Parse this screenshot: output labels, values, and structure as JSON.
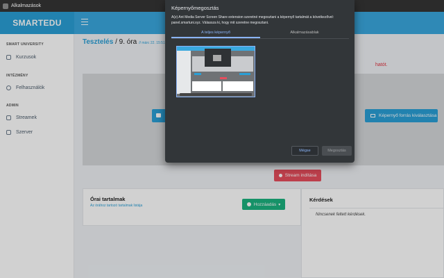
{
  "titlebar": {
    "app_name": "Alkalmazások"
  },
  "brand": {
    "name": "SMARTEDU"
  },
  "sidebar": {
    "sections": [
      {
        "label": "SMART UNIVERSITY",
        "items": [
          {
            "label": "Kurzusok",
            "icon": "book-icon"
          }
        ]
      },
      {
        "label": "INTÉZMÉNY",
        "items": [
          {
            "label": "Felhasználók",
            "icon": "user-icon"
          }
        ]
      },
      {
        "label": "ADMIN",
        "items": [
          {
            "label": "Streamek",
            "icon": "video-icon"
          },
          {
            "label": "Szerver",
            "icon": "server-icon"
          }
        ]
      }
    ]
  },
  "breadcrumb": {
    "course": "Tesztelés",
    "separator": " / ",
    "lesson": "9. óra",
    "date": "// márc 22. 15:51"
  },
  "main": {
    "error_text": "hatót.",
    "screen_button": "Képernyő forrás kiválasztása",
    "stream_button": "Stream indítása"
  },
  "content_card": {
    "title": "Órai tartalmak",
    "subtitle": "Az órához tartozó tartalmak listája",
    "add_button": "Hozzáadás"
  },
  "questions_card": {
    "title": "Kérdések",
    "empty": "Nincsenek feltett kérdések."
  },
  "dialog": {
    "title": "Képernyőmegosztás",
    "description": "A(z) Ant Media Server Screen Share extension szeretné megosztani a képernyő tartalmát a következővel: panel.smartuni.xyz. Válassza ki, hogy mit szeretne megosztani.",
    "tabs": [
      "A teljes képernyő",
      "Alkalmazásablak"
    ],
    "active_tab": 0,
    "share_button": "Mégse",
    "disabled_button": "Megosztás"
  },
  "colors": {
    "accent": "#2a9fd6",
    "danger": "#e64d5c",
    "success": "#1cb37f",
    "dialog_bg": "#323639"
  }
}
